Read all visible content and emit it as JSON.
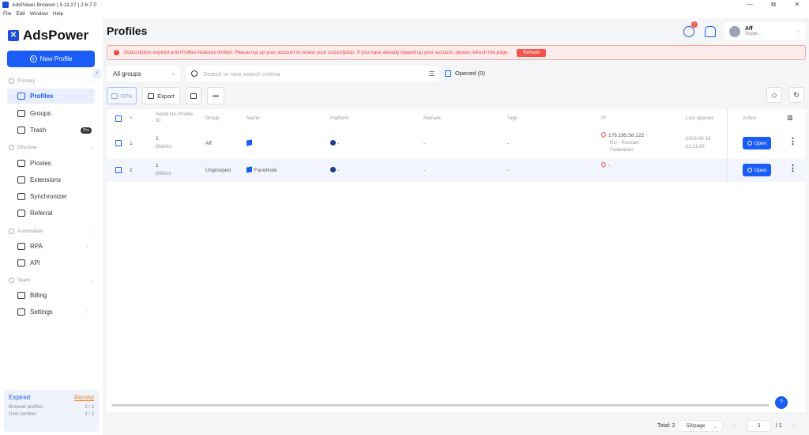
{
  "window": {
    "title": "AdsPower Browser | 5.11.27 | 2.6.7.0",
    "controls": [
      "—",
      "⧉",
      "✕"
    ]
  },
  "menu": [
    "File",
    "Edit",
    "Window",
    "Help"
  ],
  "brand": {
    "name": "AdsPower",
    "accent": "#1a5cf5"
  },
  "sidebar": {
    "new_profile": "New Profile",
    "sections": {
      "primary": "Primary",
      "discover": "Discover",
      "automation": "Automation",
      "team": "Team"
    },
    "items": {
      "profiles": "Profiles",
      "groups": "Groups",
      "trash": "Trash",
      "trash_tag": "Pro",
      "proxies": "Proxies",
      "extensions": "Extensions",
      "synchronizer": "Synchronizer",
      "referral": "Referral",
      "rpa": "RPA",
      "api": "API",
      "billing": "Billing",
      "settings": "Settings"
    },
    "plan": {
      "status": "Expired",
      "renew": "Renew",
      "browser_profiles_label": "Browser profiles",
      "browser_profiles_value": "2 / 2",
      "user_number_label": "User number",
      "user_number_value": "1 / 2"
    }
  },
  "header": {
    "title": "Profiles",
    "notification_count": "1",
    "user": {
      "name": "Aff",
      "role": "Super..."
    }
  },
  "banner": {
    "text": "Subscription expired and Profiles features limited. Please top up your account to renew your subscription. If you have already topped up your account, please refresh the page.",
    "button": "Refresh"
  },
  "filters": {
    "group": "All groups",
    "search_placeholder": "Search or new search criteria",
    "opened": "Opened (0)"
  },
  "toolbar": {
    "rpa": "RPA",
    "export": "Export",
    "more": "•••"
  },
  "table": {
    "columns": {
      "num": "#",
      "serial": "Serial No./Profile ID",
      "group": "Group",
      "name": "Name",
      "platform": "Platform",
      "remark": "Remark",
      "tags": "Tags",
      "ip": "IP",
      "last_opened": "Last opened",
      "action": "Action"
    },
    "rows": [
      {
        "num": "1",
        "serial": "2",
        "profile_id": "j9kb0cc",
        "group": "Aff",
        "name": "",
        "platform": "-",
        "remark": "-",
        "tags": "-",
        "ip": "176.195.58.122",
        "ip_country": "RU - Russian Federation",
        "last_opened_date": "2023-08-16",
        "last_opened_time": "21:11:00",
        "open": "Open"
      },
      {
        "num": "2",
        "serial": "1",
        "profile_id": "j66ihox",
        "group": "Ungrouped",
        "name": "Facebook",
        "platform": "-",
        "remark": "-",
        "tags": "-",
        "ip": "-",
        "ip_country": "-",
        "last_opened_date": "-",
        "last_opened_time": "",
        "open": "Open"
      }
    ]
  },
  "footer": {
    "total": "Total: 2",
    "per_page": "50/page",
    "page": "1",
    "page_total": "/ 1"
  }
}
